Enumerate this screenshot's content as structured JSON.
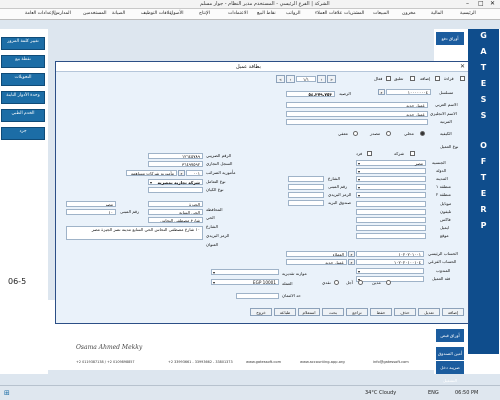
{
  "window": {
    "title": "الشركة | الفرع الرئيسي - المستخدم مدير النظام - جوار مسلم"
  },
  "menu": [
    "الرئيسية",
    "المالية",
    "مخزون",
    "المبيعات",
    "المشتريات",
    "علاقات العملاء",
    "الرواتب",
    "نقاط البيع",
    "الاعتمادات",
    "الإنتاج",
    "الأصول",
    "علاقات التوظيف",
    "الصيانة",
    "المستخدمين",
    "المدارس",
    "الإعدادات العامة"
  ],
  "left_buttons": [
    "تغيير كلمة المرور",
    "نقطة بيع",
    "التحويلات",
    "وحدة الأدوار الثابتة",
    "الخدم الطبي",
    "جرد"
  ],
  "right_panel": {
    "brand": [
      "G",
      "A",
      "T",
      "E",
      "S",
      "S",
      "O",
      "F",
      "T",
      "E",
      "R",
      "P"
    ],
    "tabs": [
      "أوراق قبض",
      "أوراق دفع"
    ],
    "bottom_links": [
      "أمين الصندوق",
      "ضريبة دخل التشغيل"
    ]
  },
  "footer": {
    "sig_name": "Osama Ahmed Mekky",
    "phone": "+2 0119387138 / +2 0109898857",
    "tel2": "+2 33993661 - 33993662 - 33801373",
    "site1": "www.gatessoft.com",
    "site2": "www.accounting-app.org",
    "email": "info@gatessoft.com",
    "bottom_left": "06-5"
  },
  "taskbar": {
    "weather": "34°C  Cloudy",
    "time": "06:50 PM",
    "lang": "ENG"
  },
  "dialog": {
    "title": "بطاقة عميل",
    "top_checks": [
      "فعال",
      "تعليق",
      "إضافة",
      "قراءة"
    ],
    "pager": "١/١",
    "code_label": "مسلسل",
    "code": "١٠٠٠٠٠٠٠٤",
    "balance_label": "الرصيد",
    "balance": "٥٤,٣٧٩,٧٥٣",
    "name_ar_label": "الاسم العربي",
    "name_ar": "عميل جديد",
    "name_en_label": "الاسم الانجليزي",
    "name_en": "عميل جديد",
    "level_label": "المرتبة",
    "type_label": "الكيفية",
    "type_opts": [
      "محلي",
      "مصدر",
      "معفي"
    ],
    "client_kind_label": "نوع العميل",
    "client_kind_opts": [
      "شركة",
      "فرد"
    ],
    "nationality_label": "الجنسية",
    "nationality": "مصر",
    "country_label": "الدولة",
    "city_label": "المدينة",
    "area_label": "منطقة ١",
    "area2_label": "منطقة ٢",
    "street_label": "الشارع",
    "building_label": "رقم المبنى",
    "zip_label": "الرمز البريدي",
    "pobox_label": "صندوق البريد",
    "mobile_label": "موبايل",
    "phone_label": "تليفون",
    "fax_label": "فاكس",
    "email_label": "ايميل",
    "website_label": "موقع",
    "tax_label": "الرقم الضريبي",
    "tax": "١٢٦٤٥٧٨٩",
    "commercial_label": "السجل التجاري",
    "commercial": "٣٦٤٩٧٥٩٢",
    "activity_label": "نوع التعامل",
    "auth_label": "مأمورية الضرائب",
    "auth_code": "٠٠١",
    "auth_name": "مأمورية شركات مساهمة",
    "entity_label": "نوع الكيان",
    "entity": "شركة تجارية بمصرية",
    "gov_label": "المحافظة",
    "gov_val": "مصر",
    "gov_city_label": "الحي",
    "district": "الجيزة",
    "district2": "الحي السابع",
    "building_no_label": "رقم المبنى",
    "building_no": "١٠",
    "street2_label": "الشارع",
    "street2": "شارع مصطفى النحاس",
    "zip2_label": "الرمز البريدي",
    "address_label": "العنوان",
    "address": "١٠ شارع مصطفى النحاس الحي السابع مدينة نصر الجيزة مصر",
    "account_label": "الحساب الرئيسي",
    "account_code": "١٠٢٠٢٠١٠٠١",
    "account_name": "العملاء",
    "sub_account_label": "الحساب الفرعي",
    "sub_code": "١٠٢٠٢٠١٠٠١٠٤",
    "sub_name": "عميل جديد",
    "rep_label": "المندوب",
    "group_label": "فئة العميل",
    "budget_label": "موازنة تقديرية",
    "currency_label": "العملة",
    "currency": "EGP 10001",
    "credit_opts": [
      "نقدي",
      "آجل",
      "مدين"
    ],
    "limit_label": "حد الائتمان",
    "notes_label": "ملاحظات",
    "buttons": [
      "إضافة",
      "تعديل",
      "حذف",
      "حفظ",
      "تراجع",
      "بحث",
      "استعلام",
      "طباعة",
      "خروج"
    ]
  }
}
